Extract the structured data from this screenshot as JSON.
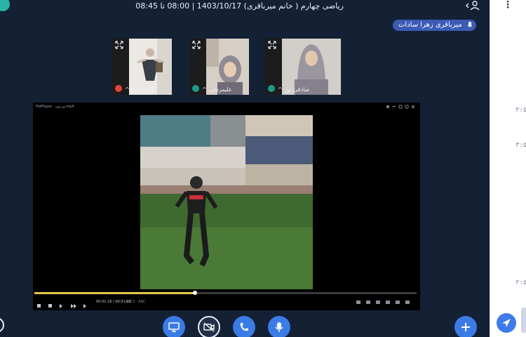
{
  "header": {
    "title": "ریاضی چهارم ( خانم میرباقری) 1403/10/17 | 08:00 تا 08:45"
  },
  "speaker": {
    "name": "میرباقری زهرا سادات"
  },
  "participants": [
    {
      "name": "قلیچ درسا",
      "badge_color": "#e0443a",
      "photo": "dance"
    },
    {
      "name": "علیمردانی",
      "badge_color": "#1f9a8a",
      "photo": "scarf-face"
    },
    {
      "name": "صادقی نور",
      "badge_color": "#1f9a8a",
      "photo": "scarf-grey"
    }
  ],
  "player": {
    "title": "PotPlayer",
    "file": "ورزش.mp4",
    "clock": "00:01:16",
    "total": "00:01:28",
    "format": "AVC1",
    "audio": "AAC",
    "progress": 0.42,
    "volume": 0.9
  },
  "chat": {
    "times": [
      "۳:۵",
      "۳:۵",
      "۳:۵"
    ]
  },
  "toolbar": {
    "buttons": [
      "screen-share",
      "camera-off",
      "phone",
      "microphone",
      "add"
    ]
  },
  "colors": {
    "accent": "#3a7be6",
    "stage": "#142034",
    "speaker_pill": "#3b5bb5"
  }
}
